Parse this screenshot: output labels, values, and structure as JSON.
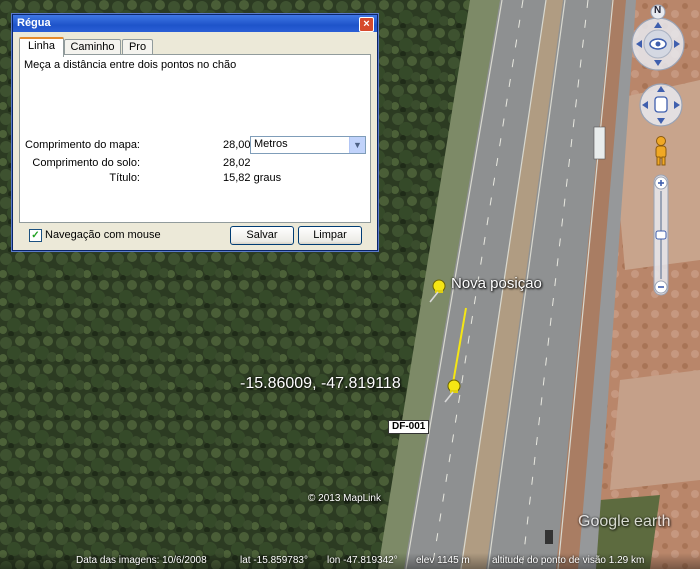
{
  "dialog": {
    "title": "Régua",
    "tabs": [
      {
        "label": "Linha"
      },
      {
        "label": "Caminho"
      },
      {
        "label": "Pro"
      }
    ],
    "description": "Meça a distância entre dois pontos no chão",
    "map_length_label": "Comprimento do mapa:",
    "map_length_value": "28,00",
    "unit_selected": "Metros",
    "ground_length_label": "Comprimento do solo:",
    "ground_length_value": "28,02",
    "heading_label": "Título:",
    "heading_value": "15,82 graus",
    "mouse_nav_label": "Navegação com mouse",
    "mouse_nav_checked": true,
    "save_label": "Salvar",
    "clear_label": "Limpar"
  },
  "map": {
    "placemark_label": "Nova posiçao",
    "coordinates_label": "-15.86009, -47.819118",
    "road_label": "DF-001",
    "copyright": "© 2013 MapLink",
    "logo": "Google earth",
    "compass_letter": "N"
  },
  "status": {
    "image_date": "Data das imagens: 10/6/2008",
    "lat": "lat  -15.859783°",
    "lon": "lon  -47.819342°",
    "elev": "elev  1145 m",
    "eye_alt": "altitude do ponto de visão   1.29 km"
  },
  "colors": {
    "arrow": "#e8102a",
    "pin": "#f5e614",
    "ruler_line": "#f5e614"
  }
}
